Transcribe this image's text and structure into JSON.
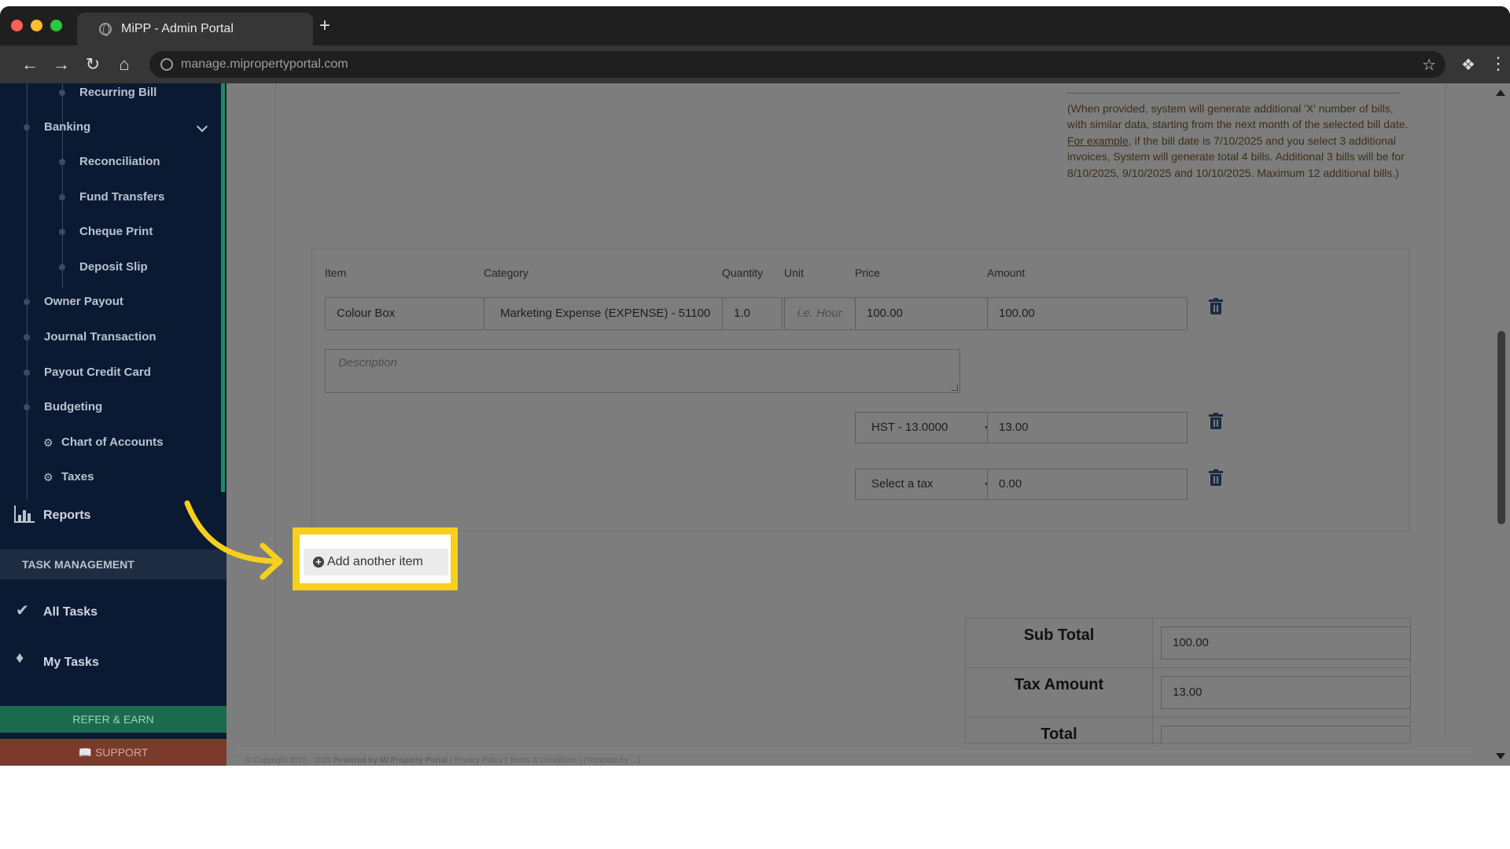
{
  "browser": {
    "tab_title": "MiPP - Admin Portal",
    "new_tab": "+",
    "url": "manage.mipropertyportal.com"
  },
  "sidebar": {
    "items": [
      {
        "label": "Recurring Bill"
      },
      {
        "label": "Banking"
      },
      {
        "label": "Reconciliation"
      },
      {
        "label": "Fund Transfers"
      },
      {
        "label": "Cheque Print"
      },
      {
        "label": "Deposit Slip"
      },
      {
        "label": "Owner Payout"
      },
      {
        "label": "Journal Transaction"
      },
      {
        "label": "Payout Credit Card"
      },
      {
        "label": "Budgeting"
      },
      {
        "label": "Chart of Accounts"
      },
      {
        "label": "Taxes"
      }
    ],
    "reports": "Reports",
    "task_header": "TASK MANAGEMENT",
    "all_tasks": "All Tasks",
    "my_tasks": "My Tasks",
    "refer": "REFER & EARN",
    "support": "SUPPORT"
  },
  "help": {
    "part1": "(When provided, system will generate additional 'X' number of bills, with similar data, starting from the next month of the selected bill date. ",
    "link": "For example",
    "part2": ", if the bill date is 7/10/2025 and you select 3 additional invoices, System will generate total 4 bills. Additional 3 bills will be for 8/10/2025, 9/10/2025 and 10/10/2025. Maximum 12 additional bills.)"
  },
  "items": {
    "headers": {
      "item": "Item",
      "category": "Category",
      "quantity": "Quantity",
      "unit": "Unit",
      "price": "Price",
      "amount": "Amount"
    },
    "row": {
      "item": "Colour Box",
      "category": "Marketing Expense (EXPENSE) - 51100",
      "quantity": "1.0",
      "unit_placeholder": "i.e. Hour",
      "price": "100.00",
      "amount": "100.00",
      "description_placeholder": "Description"
    },
    "taxes": [
      {
        "name": "HST - 13.0000",
        "amount": "13.00"
      },
      {
        "name": "Select a tax",
        "amount": "0.00"
      }
    ]
  },
  "add_item": "Add another item",
  "totals": {
    "sub_total_label": "Sub Total",
    "sub_total": "100.00",
    "tax_label": "Tax Amount",
    "tax": "13.00",
    "total_label": "Total"
  },
  "footer": {
    "copyright": "© Copyright 2016 - 2025",
    "powered": "Powered by MI Property Portal",
    "links": "| Privacy Policy | Terms & Conditions |",
    "template": "(Template by ...)"
  },
  "colors": {
    "highlight": "#f7d01e",
    "sidebar_bg": "#0b1a33",
    "refer_bg": "#1a6b4e",
    "support_bg": "#7a3b2b"
  }
}
